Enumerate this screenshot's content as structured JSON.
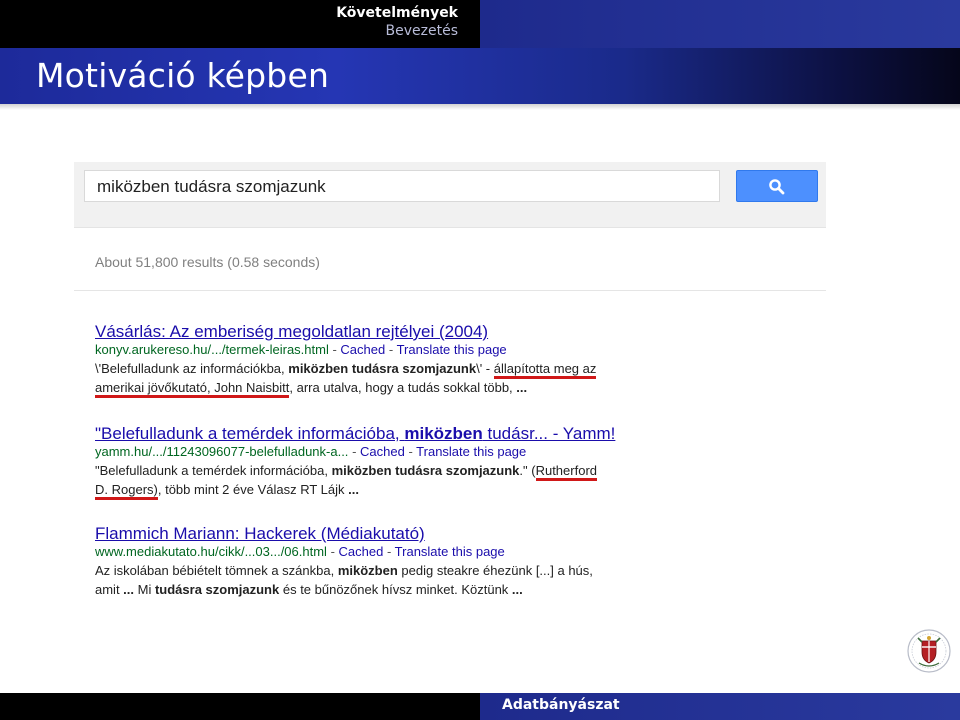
{
  "header": {
    "section": "Követelmények",
    "subsection": "Bevezetés",
    "frame_title": "Motiváció képben"
  },
  "search": {
    "query": "miközben tudásra szomjazunk",
    "button_icon": "search-icon",
    "button_color": "#4d90fe"
  },
  "results_stats": "About 51,800 results (0.58 seconds)",
  "results": [
    {
      "title": "Vásárlás: Az emberiség megoldatlan rejtélyei (2004)",
      "url": "konyv.arukereso.hu/.../termek-leiras.html",
      "cached": "Cached",
      "translate": "Translate this page",
      "snippet_line1": {
        "a": "\\'Belefulladunk az információkba, ",
        "b": "miközben tudásra szomjazunk",
        "c": "\\' - ",
        "d": "állapította meg az"
      },
      "snippet_line2": {
        "a": "amerikai jövőkutató, John Naisbitt",
        "b": ", arra utalva, hogy a tudás sokkal több, ",
        "c": "..."
      }
    },
    {
      "title_pre": "\"Belefulladunk a temérdek információba, ",
      "title_bold": "miközben",
      "title_post": " tudásr... - Yamm!",
      "url": "yamm.hu/.../11243096077-belefulladunk-a...",
      "cached": "Cached",
      "translate": "Translate this page",
      "snippet_line1": {
        "a": "\"Belefulladunk a temérdek információba, ",
        "b": "miközben tudásra szomjazunk",
        "c": ".\" (",
        "d": "Rutherford"
      },
      "snippet_line2": {
        "a": "D. Rogers)",
        "b": ", több mint 2 éve Válasz RT Lájk ",
        "c": "..."
      }
    },
    {
      "title": "Flammich Mariann: Hackerek (Médiakutató)",
      "url": "www.mediakutato.hu/cikk/...03.../06.html",
      "cached": "Cached",
      "translate": "Translate this page",
      "snippet_line1": {
        "a": "Az iskolában bébiételt tömnek a szánkba, ",
        "b": "miközben",
        "c": " pedig steakre éhezünk [...] a hús,"
      },
      "snippet_line2": {
        "a": "amit ",
        "b": "...",
        "c": " Mi ",
        "d": "tudásra szomjazunk",
        "e": " és te bűnözőnek hívsz minket. Köztünk ",
        "f": "..."
      }
    }
  ],
  "footer": {
    "right_text": "Adatbányászat"
  },
  "colors": {
    "header_black": "#000000",
    "header_blue": "#1e2a8c",
    "link": "#1a0dab",
    "url_green": "#006621",
    "underline_red": "#d01818"
  }
}
